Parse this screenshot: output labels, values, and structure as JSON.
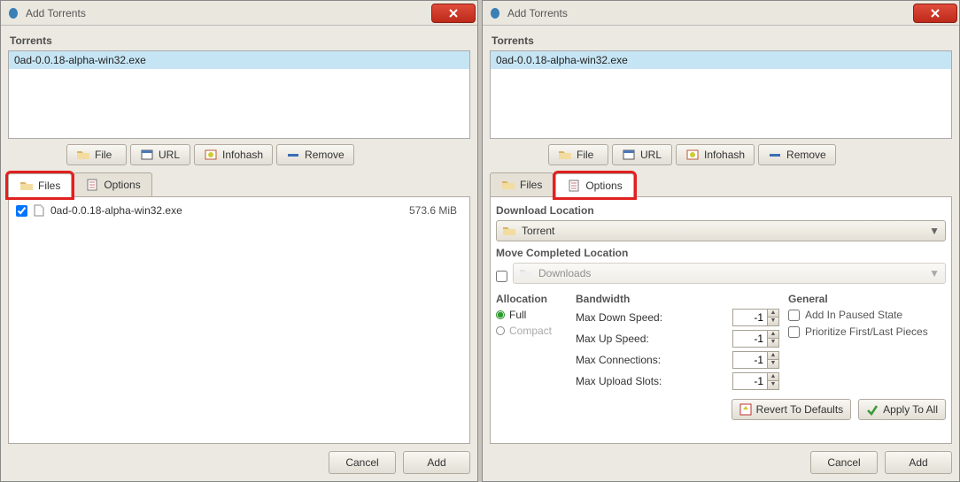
{
  "left": {
    "title": "Add Torrents",
    "section_torrents": "Torrents",
    "torrent_item": "0ad-0.0.18-alpha-win32.exe",
    "toolbar": {
      "file": "File",
      "url": "URL",
      "infohash": "Infohash",
      "remove": "Remove"
    },
    "tabs": {
      "files": "Files",
      "options": "Options"
    },
    "file_row": {
      "name": "0ad-0.0.18-alpha-win32.exe",
      "size": "573.6 MiB"
    },
    "buttons": {
      "cancel": "Cancel",
      "add": "Add"
    }
  },
  "right": {
    "title": "Add Torrents",
    "section_torrents": "Torrents",
    "torrent_item": "0ad-0.0.18-alpha-win32.exe",
    "toolbar": {
      "file": "File",
      "url": "URL",
      "infohash": "Infohash",
      "remove": "Remove"
    },
    "tabs": {
      "files": "Files",
      "options": "Options"
    },
    "options": {
      "dl_location_label": "Download Location",
      "dl_location_value": "Torrent",
      "move_completed_label": "Move Completed Location",
      "move_completed_value": "Downloads",
      "allocation_label": "Allocation",
      "allocation_full": "Full",
      "allocation_compact": "Compact",
      "bandwidth_label": "Bandwidth",
      "bw_rows": {
        "down": {
          "label": "Max Down Speed:",
          "value": "-1"
        },
        "up": {
          "label": "Max Up Speed:",
          "value": "-1"
        },
        "conn": {
          "label": "Max Connections:",
          "value": "-1"
        },
        "slots": {
          "label": "Max Upload Slots:",
          "value": "-1"
        }
      },
      "general_label": "General",
      "general_paused": "Add In Paused State",
      "general_prioritize": "Prioritize First/Last Pieces",
      "revert": "Revert To Defaults",
      "apply_all": "Apply To All"
    },
    "buttons": {
      "cancel": "Cancel",
      "add": "Add"
    }
  }
}
